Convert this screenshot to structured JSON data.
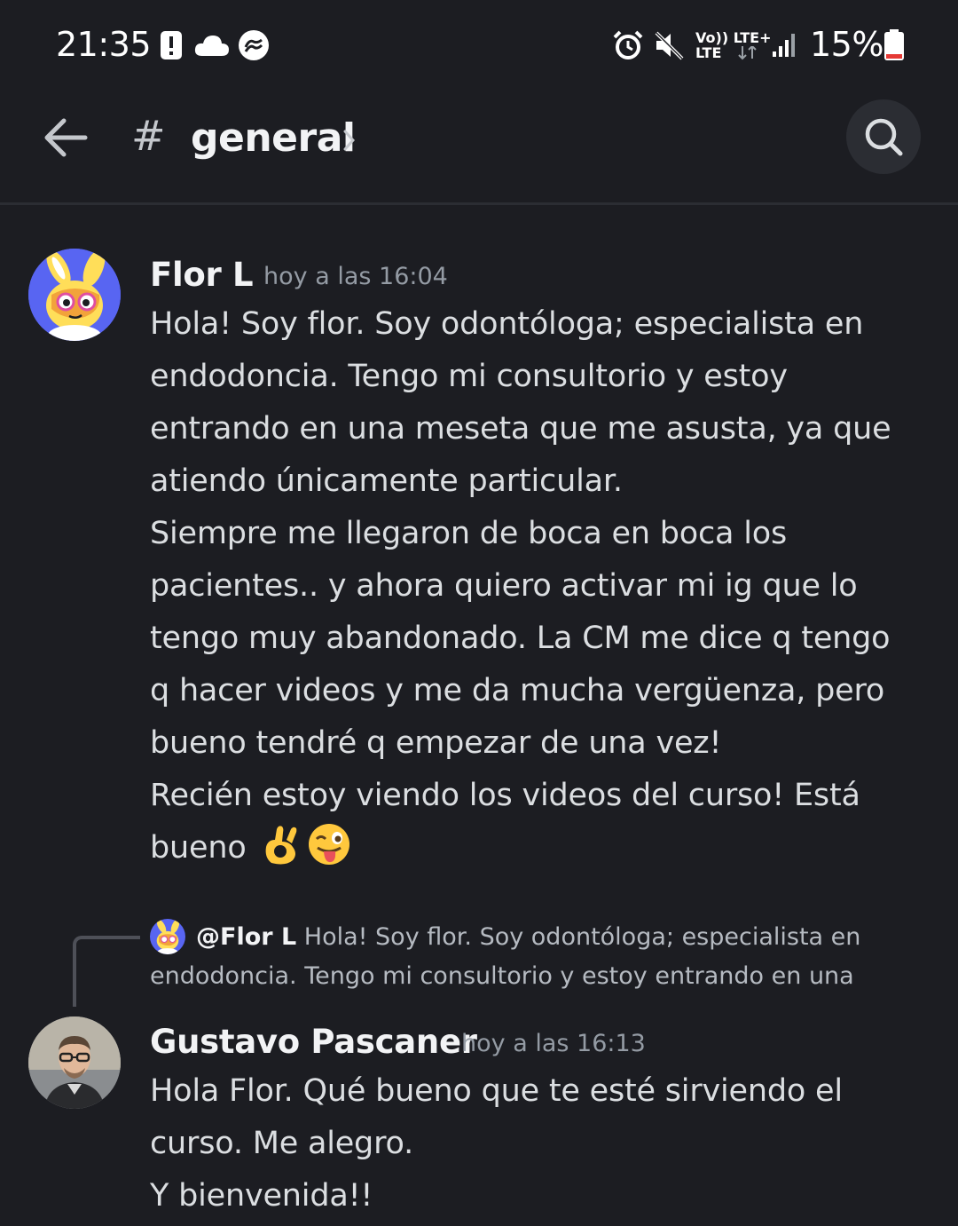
{
  "status_bar": {
    "time": "21:35",
    "network_top": "Vo)) LTE+",
    "network_bottom": "LTE",
    "battery": "15%",
    "left_icons": [
      "alert-icon",
      "cloud-icon",
      "sync-icon"
    ],
    "right_icons": [
      "alarm-icon",
      "mute-icon",
      "signal-icon",
      "battery-icon"
    ]
  },
  "header": {
    "hash": "#",
    "channel": "general",
    "icons": [
      "back-arrow-icon",
      "chevron-right-icon",
      "search-icon"
    ]
  },
  "messages": [
    {
      "author": "Flor L",
      "time": "hoy a las 16:04",
      "lines": [
        "Hola! Soy flor. Soy odontóloga; especialista en",
        "endodoncia. Tengo mi consultorio y estoy",
        "entrando en una meseta que me asusta, ya que",
        "atiendo únicamente particular.",
        "Siempre me llegaron de boca en boca los",
        "pacientes.. y ahora quiero activar mi ig que lo",
        "tengo muy abandonado. La CM me dice q tengo",
        "q hacer videos y me da mucha vergüenza, pero",
        "bueno tendré q empezar  de una vez!",
        "Recién estoy viendo los videos del curso! Está",
        "bueno"
      ],
      "emojis": [
        "ok-hand-emoji",
        "winking-tongue-emoji"
      ]
    },
    {
      "reply_to": {
        "author": "@Flor L",
        "line1": "Hola! Soy flor. Soy odontóloga; especialista en",
        "line2": "endodoncia. Tengo mi consultorio y estoy entrando en una"
      },
      "author": "Gustavo Pascaner",
      "time": "hoy a las 16:13",
      "lines": [
        "Hola Flor. Qué bueno que te esté sirviendo el",
        "curso. Me alegro.",
        "Y bienvenida!!"
      ]
    }
  ],
  "colors": {
    "background": "#1c1d22",
    "header_button": "#2b2d33",
    "text_primary": "#f2f3f5",
    "text_body": "#dbdee1",
    "text_muted": "#949ba4",
    "avatar_bg": "#5865f2"
  }
}
